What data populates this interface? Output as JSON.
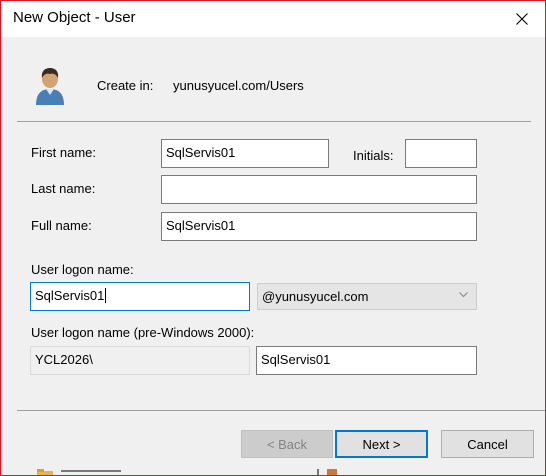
{
  "window": {
    "title": "New Object - User"
  },
  "header": {
    "create_in_label": "Create in:",
    "create_in_path": "yunusyucel.com/Users"
  },
  "form": {
    "first_name": {
      "label": "First name:",
      "value": "SqlServis01"
    },
    "initials": {
      "label": "Initials:",
      "value": ""
    },
    "last_name": {
      "label": "Last name:",
      "value": ""
    },
    "full_name": {
      "label": "Full name:",
      "value": "SqlServis01"
    },
    "logon_name": {
      "label": "User logon name:",
      "value": "SqlServis01",
      "domain_suffix": "@yunusyucel.com"
    },
    "pre2000": {
      "label": "User logon name (pre-Windows 2000):",
      "domain": "YCL2026\\",
      "value": "SqlServis01"
    }
  },
  "buttons": {
    "back": "< Back",
    "next": "Next >",
    "cancel": "Cancel"
  },
  "colors": {
    "accent": "#0078d7",
    "window_border": "#e81123",
    "dialog_bg": "#f0f0f0"
  },
  "icons": {
    "user": "user-icon",
    "close": "close-icon",
    "dropdown": "chevron-down-icon"
  }
}
